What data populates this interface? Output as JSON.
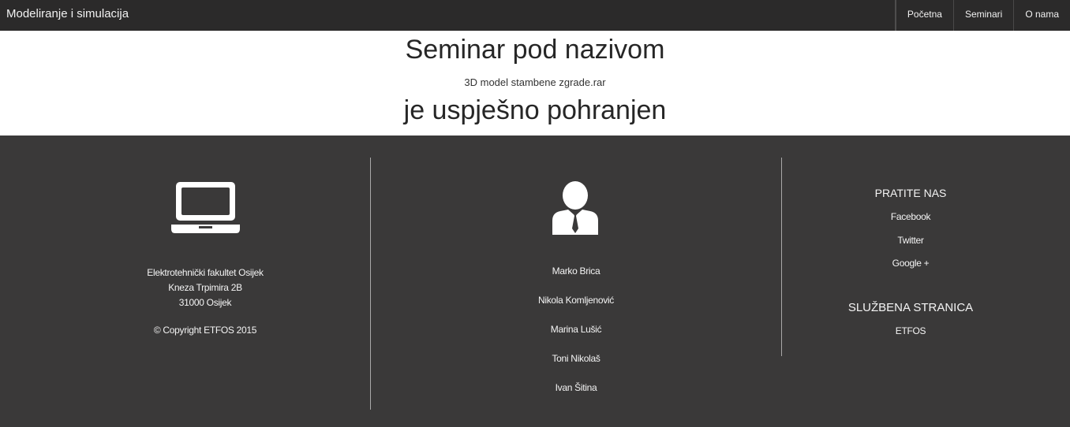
{
  "navbar": {
    "brand": "Modeliranje i simulacija",
    "items": [
      {
        "label": "Početna"
      },
      {
        "label": "Seminari"
      },
      {
        "label": "O nama"
      }
    ]
  },
  "main": {
    "heading_top": "Seminar pod nazivom",
    "filename": "3D model stambene zgrade.rar",
    "heading_bottom": "je uspješno pohranjen"
  },
  "footer": {
    "address": {
      "icon": "laptop-icon",
      "line1": "Elektrotehnički fakultet Osijek",
      "line2": "Kneza Trpimira 2B",
      "line3": "31000 Osijek",
      "copyright": "© Copyright ETFOS 2015"
    },
    "team": {
      "icon": "person-icon",
      "members": [
        "Marko Brica",
        "Nikola Komljenović",
        "Marina Lušić",
        "Toni Nikolaš",
        "Ivan Šitina"
      ]
    },
    "social": {
      "title": "PRATITE NAS",
      "links": [
        "Facebook",
        "Twitter",
        "Google +"
      ],
      "official_title": "SLUŽBENA STRANICA",
      "official_link": "ETFOS"
    }
  }
}
